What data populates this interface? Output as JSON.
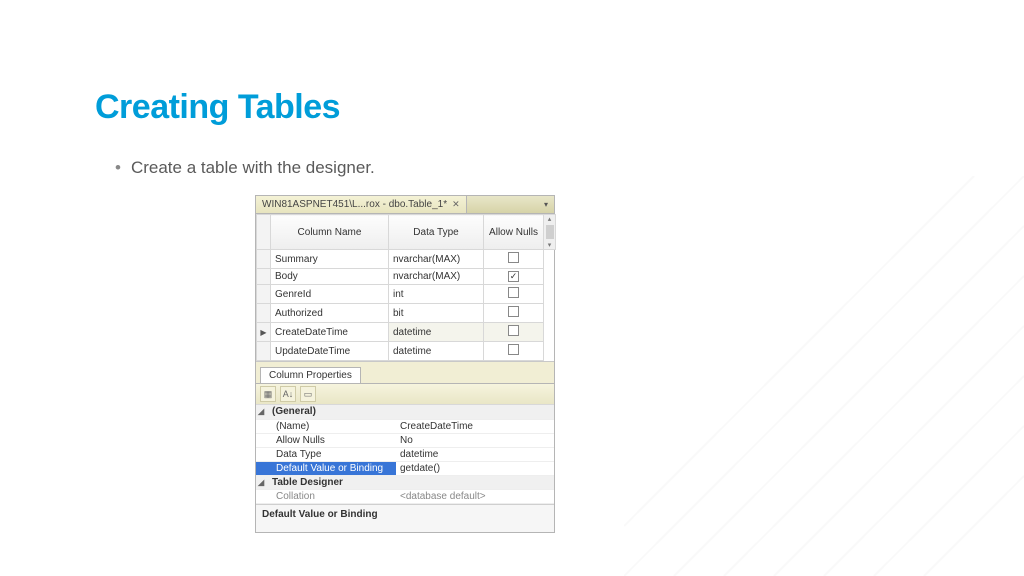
{
  "slide": {
    "title": "Creating Tables",
    "bullet": "Create a table with the designer."
  },
  "designer": {
    "tab_label": "WIN81ASPNET451\\L...rox - dbo.Table_1*",
    "grid_headers": {
      "name": "Column Name",
      "type": "Data Type",
      "nulls": "Allow Nulls"
    },
    "columns": [
      {
        "name": "Summary",
        "type": "nvarchar(MAX)",
        "allow_nulls": false,
        "selected": false
      },
      {
        "name": "Body",
        "type": "nvarchar(MAX)",
        "allow_nulls": true,
        "selected": false
      },
      {
        "name": "GenreId",
        "type": "int",
        "allow_nulls": false,
        "selected": false
      },
      {
        "name": "Authorized",
        "type": "bit",
        "allow_nulls": false,
        "selected": false
      },
      {
        "name": "CreateDateTime",
        "type": "datetime",
        "allow_nulls": false,
        "selected": true
      },
      {
        "name": "UpdateDateTime",
        "type": "datetime",
        "allow_nulls": false,
        "selected": false
      }
    ],
    "props_tab": "Column Properties",
    "props": {
      "general_label": "(General)",
      "name_key": "(Name)",
      "name_val": "CreateDateTime",
      "nulls_key": "Allow Nulls",
      "nulls_val": "No",
      "type_key": "Data Type",
      "type_val": "datetime",
      "default_key": "Default Value or Binding",
      "default_val": "getdate()",
      "designer_label": "Table Designer",
      "collation_key": "Collation",
      "collation_val": "<database default>"
    },
    "desc_bar": "Default Value or Binding"
  }
}
